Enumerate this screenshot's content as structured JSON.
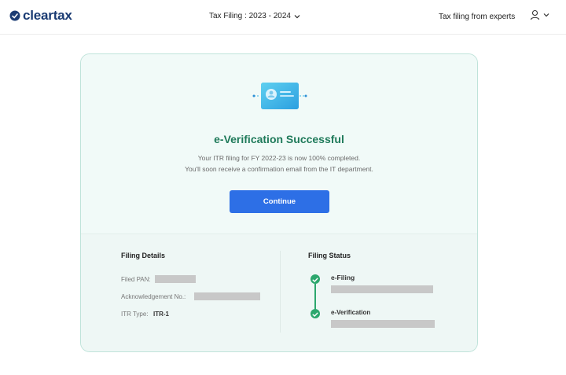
{
  "header": {
    "logo_text": "cleartax",
    "year_select": "Tax Filing : 2023 - 2024",
    "experts_link": "Tax filing from experts"
  },
  "card": {
    "title": "e-Verification Successful",
    "subtitle_line1": "Your ITR filing for FY 2022-23 is now 100% completed.",
    "subtitle_line2": "You'll soon receive a confirmation email from the IT department.",
    "continue_label": "Continue"
  },
  "filing_details": {
    "title": "Filing Details",
    "filed_pan_label": "Filed PAN:",
    "ack_label": "Acknowledgement No.:",
    "itr_type_label": "ITR Type:",
    "itr_type_value": "ITR-1"
  },
  "filing_status": {
    "title": "Filing Status",
    "steps": [
      {
        "label": "e-Filing"
      },
      {
        "label": "e-Verification"
      }
    ]
  },
  "colors": {
    "brand": "#1a3b73",
    "accent_blue": "#2d6fe6",
    "success_green": "#1f7a5a",
    "step_green": "#2ca76d"
  },
  "icons": [
    "cleartax-logo-icon",
    "chevron-down-icon",
    "user-icon",
    "id-card-icon",
    "check-icon"
  ]
}
